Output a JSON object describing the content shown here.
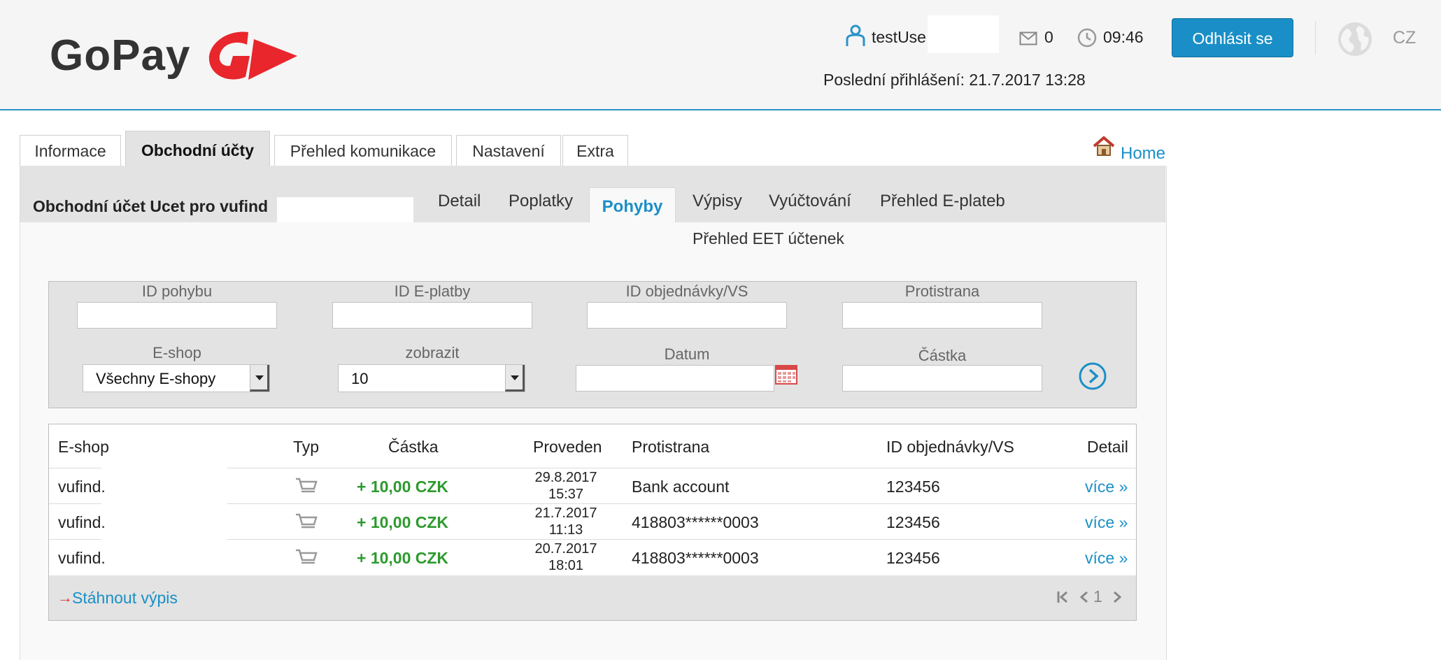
{
  "header": {
    "brand": "GoPay",
    "username": "testUse",
    "message_count": "0",
    "time": "09:46",
    "logout_label": "Odhlásit se",
    "language": "CZ",
    "last_login": "Poslední přihlášení: 21.7.2017 13:28"
  },
  "main_tabs": [
    {
      "label": "Informace"
    },
    {
      "label": "Obchodní účty"
    },
    {
      "label": "Přehled komunikace"
    },
    {
      "label": "Nastavení"
    },
    {
      "label": "Extra"
    }
  ],
  "home_link": "Home",
  "account": {
    "title": "Obchodní účet Ucet pro vufind"
  },
  "sub_tabs": [
    {
      "label": "Detail"
    },
    {
      "label": "Poplatky"
    },
    {
      "label": "Pohyby"
    },
    {
      "label": "Výpisy"
    },
    {
      "label": "Vyúčtování"
    },
    {
      "label": "Přehled E-plateb"
    }
  ],
  "eet_link": "Přehled EET účtenek",
  "filter": {
    "labels": {
      "movement_id": "ID pohybu",
      "epayment_id": "ID E-platby",
      "order_id": "ID objednávky/VS",
      "counterparty": "Protistrana",
      "eshop": "E-shop",
      "show": "zobrazit",
      "date": "Datum",
      "amount": "Částka"
    },
    "eshop_value": "Všechny E-shopy",
    "show_value": "10"
  },
  "table": {
    "headers": {
      "eshop": "E-shop",
      "type": "Typ",
      "amount": "Částka",
      "date": "Proveden",
      "counterparty": "Protistrana",
      "order_id": "ID objednávky/VS",
      "detail": "Detail"
    },
    "rows": [
      {
        "eshop": "vufind.",
        "amount": "+ 10,00 CZK",
        "date": "29.8.2017",
        "time": "15:37",
        "counterparty": "Bank account",
        "order_id": "123456",
        "detail": "více »"
      },
      {
        "eshop": "vufind.",
        "amount": "+ 10,00 CZK",
        "date": "21.7.2017",
        "time": "11:13",
        "counterparty": "418803******0003",
        "order_id": "123456",
        "detail": "více »"
      },
      {
        "eshop": "vufind.",
        "amount": "+ 10,00 CZK",
        "date": "20.7.2017",
        "time": "18:01",
        "counterparty": "418803******0003",
        "order_id": "123456",
        "detail": "více »"
      }
    ],
    "download_label": "Stáhnout výpis",
    "page": "1"
  },
  "colors": {
    "accent": "#1a8fc7",
    "brand_red": "#e8262c",
    "amount_green": "#2e9a2e"
  }
}
